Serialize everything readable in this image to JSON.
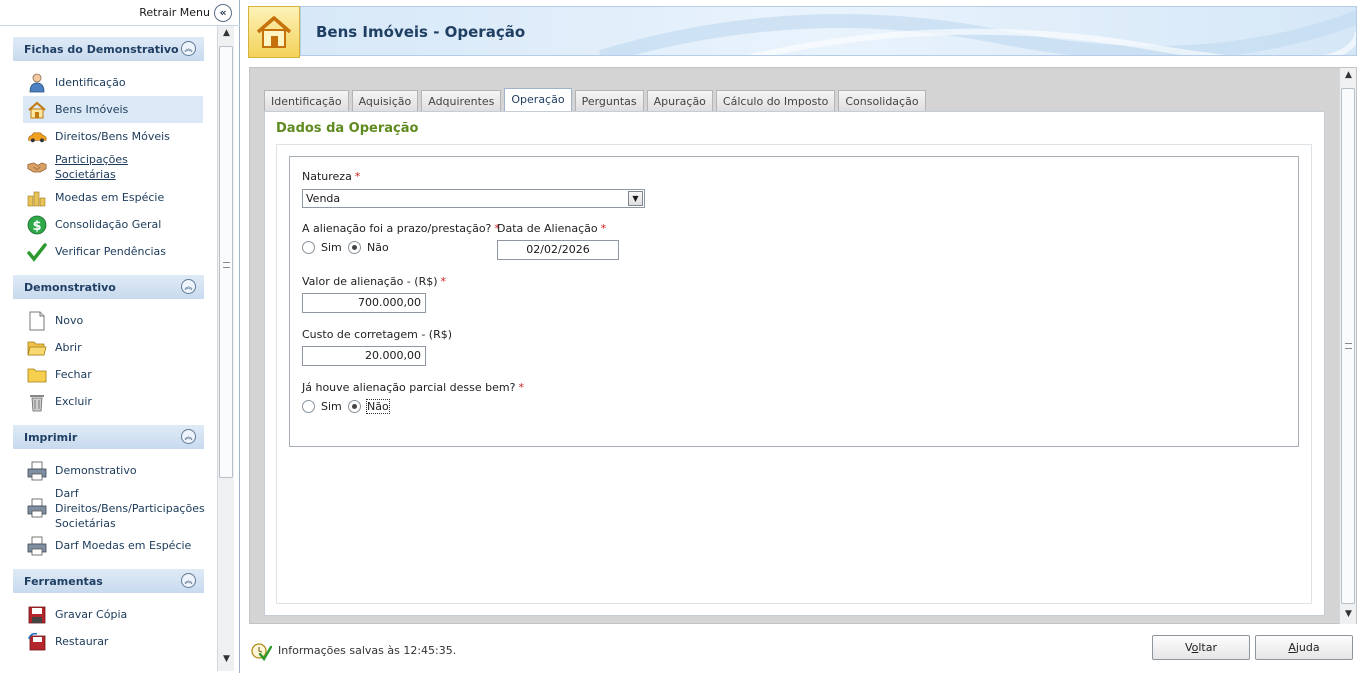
{
  "sidebar": {
    "collapse_label": "Retrair Menu",
    "groups": [
      {
        "title": "Fichas do Demonstrativo",
        "items": [
          {
            "label": "Identificação",
            "icon": "person-icon"
          },
          {
            "label": "Bens Imóveis",
            "icon": "house-icon",
            "selected": true
          },
          {
            "label": "Direitos/Bens Móveis",
            "icon": "car-icon"
          },
          {
            "label": "Participações Societárias",
            "icon": "handshake-icon"
          },
          {
            "label": "Moedas em Espécie",
            "icon": "coins-icon"
          },
          {
            "label": "Consolidação Geral",
            "icon": "dollar-icon"
          },
          {
            "label": "Verificar Pendências",
            "icon": "checkmark-icon"
          }
        ]
      },
      {
        "title": "Demonstrativo",
        "items": [
          {
            "label": "Novo",
            "icon": "new-document-icon"
          },
          {
            "label": "Abrir",
            "icon": "open-folder-icon"
          },
          {
            "label": "Fechar",
            "icon": "folder-icon"
          },
          {
            "label": "Excluir",
            "icon": "trash-icon"
          }
        ]
      },
      {
        "title": "Imprimir",
        "items": [
          {
            "label": "Demonstrativo",
            "icon": "printer-icon"
          },
          {
            "label": "Darf Direitos/Bens/Participações Societárias",
            "icon": "printer-icon"
          },
          {
            "label": "Darf Moedas em Espécie",
            "icon": "printer-icon"
          }
        ]
      },
      {
        "title": "Ferramentas",
        "items": [
          {
            "label": "Gravar Cópia",
            "icon": "save-icon"
          },
          {
            "label": "Restaurar",
            "icon": "restore-icon"
          }
        ]
      }
    ]
  },
  "header": {
    "title": "Bens Imóveis - Operação"
  },
  "tabs": [
    "Identificação",
    "Aquisição",
    "Adquirentes",
    "Operação",
    "Perguntas",
    "Apuração",
    "Cálculo do Imposto",
    "Consolidação"
  ],
  "active_tab": "Operação",
  "section": {
    "title": "Dados da Operação"
  },
  "form": {
    "natureza": {
      "label": "Natureza",
      "required": "*",
      "value": "Venda"
    },
    "alienacao_prazo": {
      "label": "A alienação foi a prazo/prestação?",
      "required": "*",
      "option_yes": "Sim",
      "option_no": "Não",
      "selected": "Não"
    },
    "data_alienacao": {
      "label": "Data de Alienação",
      "required": "*",
      "value": "02/02/2026"
    },
    "valor_alienacao": {
      "label": "Valor de alienação - (R$)",
      "required": "*",
      "value": "700.000,00"
    },
    "custo_corretagem": {
      "label": "Custo de corretagem - (R$)",
      "value": "20.000,00"
    },
    "alienacao_parcial": {
      "label": "Já houve alienação parcial desse bem?",
      "required": "*",
      "option_yes": "Sim",
      "option_no": "Não",
      "selected": "Não"
    }
  },
  "footer": {
    "status": "Informações salvas às 12:45:35.",
    "voltar_pre": "V",
    "voltar_ul": "o",
    "voltar_post": "ltar",
    "ajuda_ul": "A",
    "ajuda_post": "juda"
  },
  "colors": {
    "accent_title": "#1f3f63",
    "section_green": "#5f8a1f",
    "required_red": "#d02020",
    "group_header": "#c8daee"
  }
}
